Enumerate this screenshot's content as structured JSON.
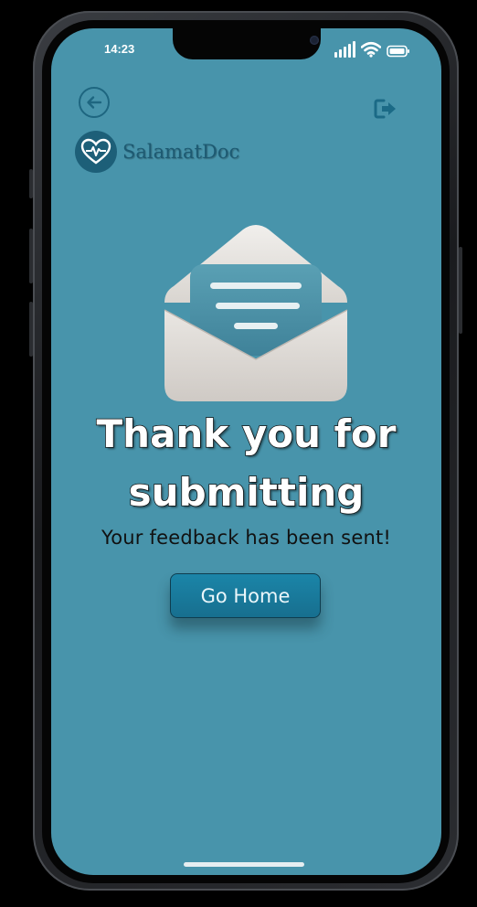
{
  "status_bar": {
    "time": "14:23"
  },
  "header": {
    "back_icon": "arrow-left-circle-icon",
    "logout_icon": "logout-icon"
  },
  "brand": {
    "name": "SalamatDoc",
    "logo_icon": "heart-pulse-icon"
  },
  "illustration": {
    "icon": "open-envelope-letter-icon"
  },
  "main": {
    "title_line1": "Thank you for",
    "title_line2": "submitting",
    "subtitle": "Your feedback has been sent!",
    "home_button_label": "Go Home"
  },
  "colors": {
    "screen_bg": "#4894ab",
    "accent": "#1b85a8",
    "brand_text": "#1d5a72"
  }
}
